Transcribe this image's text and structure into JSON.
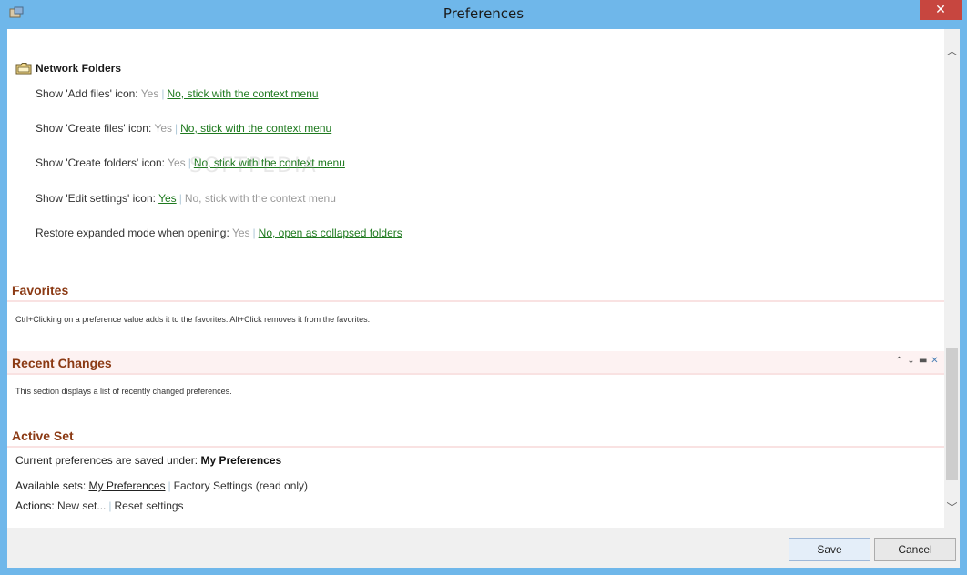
{
  "window": {
    "title": "Preferences",
    "close_glyph": "✕"
  },
  "network_folders": {
    "title": "Network Folders",
    "rows": [
      {
        "label": "Show 'Add files' icon:",
        "yes": "Yes",
        "no": "No, stick with the context menu",
        "selected": "no"
      },
      {
        "label": "Show 'Create files' icon:",
        "yes": "Yes",
        "no": "No, stick with the context menu",
        "selected": "no"
      },
      {
        "label": "Show 'Create folders' icon:",
        "yes": "Yes",
        "no": "No, stick with the context menu",
        "selected": "no"
      },
      {
        "label": "Show 'Edit settings' icon:",
        "yes": "Yes",
        "no": "No, stick with the context menu",
        "selected": "yes"
      },
      {
        "label": "Restore expanded mode when opening:",
        "yes": "Yes",
        "no": "No, open as collapsed folders",
        "selected": "no"
      }
    ],
    "separator": "|"
  },
  "watermark": "SOFTPEDIA",
  "favorites": {
    "title": "Favorites",
    "description": "Ctrl+Clicking on a preference value adds it to the favorites. Alt+Click removes it from the favorites."
  },
  "recent_changes": {
    "title": "Recent Changes",
    "description": "This section displays a list of recently changed preferences."
  },
  "active_set": {
    "title": "Active Set",
    "saved_under_label": "Current preferences are saved under:",
    "saved_under_value": "My Preferences",
    "available_label": "Available sets:",
    "available_sets": [
      "My Preferences",
      "Factory Settings (read only)"
    ],
    "actions_label": "Actions:",
    "actions": [
      "New set...",
      "Reset settings"
    ]
  },
  "footer": {
    "save_label": "Save",
    "cancel_label": "Cancel"
  },
  "colors": {
    "section_title": "#8b3a14",
    "selected_option": "#1f7a1f",
    "window_frame": "#6fb7ea"
  }
}
